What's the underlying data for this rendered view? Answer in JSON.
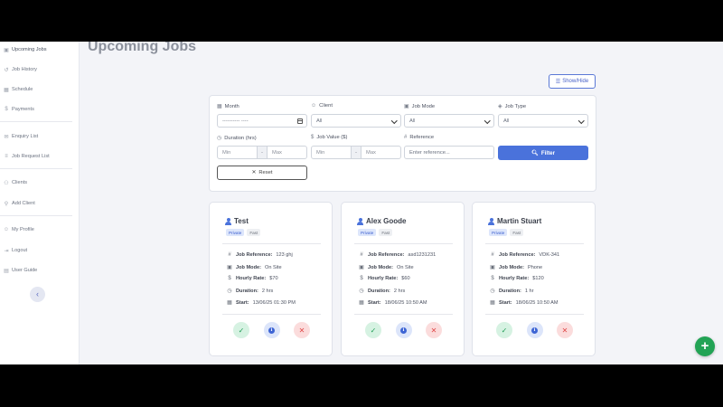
{
  "page": {
    "title": "Upcoming Jobs",
    "show_hide_label": "Show/Hide"
  },
  "sidebar": {
    "items": [
      {
        "label": "Upcoming Jobs",
        "icon": "calendar-check-icon"
      },
      {
        "label": "Job History",
        "icon": "history-icon"
      },
      {
        "label": "Schedule",
        "icon": "calendar-icon"
      },
      {
        "label": "Payments",
        "icon": "dollar-icon"
      },
      {
        "label": "Enquiry List",
        "icon": "envelope-icon"
      },
      {
        "label": "Job Request List",
        "icon": "list-icon"
      },
      {
        "label": "Clients",
        "icon": "users-icon"
      },
      {
        "label": "Add Client",
        "icon": "user-plus-icon"
      },
      {
        "label": "My Profile",
        "icon": "user-icon"
      },
      {
        "label": "Logout",
        "icon": "logout-icon"
      },
      {
        "label": "User Guide",
        "icon": "book-icon"
      }
    ],
    "collapse_glyph": "‹"
  },
  "filters": {
    "month": {
      "label": "Month",
      "placeholder": "---------- ----"
    },
    "client": {
      "label": "Client",
      "value": "All"
    },
    "job_mode": {
      "label": "Job Mode",
      "value": "All"
    },
    "job_type": {
      "label": "Job Type",
      "value": "All"
    },
    "duration": {
      "label": "Duration (hrs)",
      "min": "Min",
      "max": "Max",
      "sep": "-"
    },
    "job_value": {
      "label": "Job Value ($)",
      "min": "Min",
      "max": "Max",
      "sep": "-"
    },
    "reference": {
      "label": "Reference",
      "placeholder": "Enter reference..."
    },
    "filter_button": "Filter",
    "reset_button": "Reset"
  },
  "detail_labels": {
    "reference": "Job Reference:",
    "mode": "Job Mode:",
    "rate": "Hourly Rate:",
    "duration": "Duration:",
    "start": "Start:"
  },
  "jobs": [
    {
      "name": "Test",
      "badges": [
        "Private",
        "Fast"
      ],
      "reference": "123 ghj",
      "mode": "On Site",
      "rate": "$70",
      "duration": "2 hrs",
      "start": "13/06/25 01:30 PM"
    },
    {
      "name": "Alex Goode",
      "badges": [
        "Private",
        "Fast"
      ],
      "reference": "asd1231231",
      "mode": "On Site",
      "rate": "$60",
      "duration": "2 hrs",
      "start": "18/06/25 10:50 AM"
    },
    {
      "name": "Martin Stuart",
      "badges": [
        "Private",
        "Fast"
      ],
      "reference": "VDK-341",
      "mode": "Phone",
      "rate": "$120",
      "duration": "1 hr",
      "start": "18/06/25 10:50 AM"
    }
  ],
  "colors": {
    "accent": "#4a72db",
    "success": "#22a355",
    "danger": "#e04848"
  }
}
